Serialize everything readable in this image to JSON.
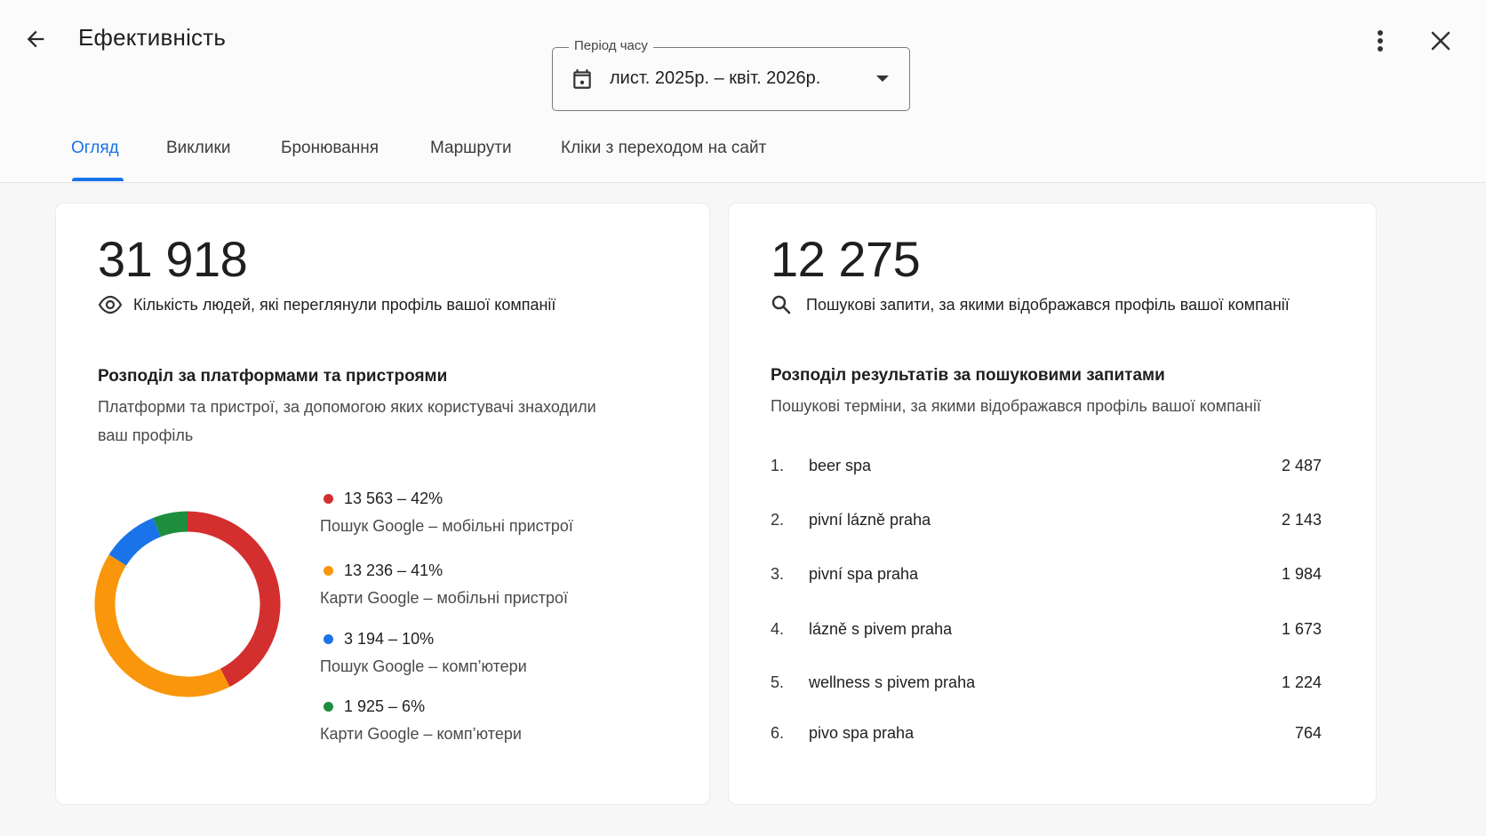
{
  "header": {
    "title": "Ефективність",
    "back_icon": "arrow-left-icon",
    "more_icon": "more-vert-icon",
    "close_icon": "close-icon"
  },
  "period": {
    "label": "Період часу",
    "value": "лист. 2025р. – квіт. 2026р.",
    "icon": "calendar-icon"
  },
  "tabs": [
    {
      "label": "Огляд",
      "active": true
    },
    {
      "label": "Виклики"
    },
    {
      "label": "Бронювання"
    },
    {
      "label": "Маршрути"
    },
    {
      "label": "Кліки з переходом на сайт"
    }
  ],
  "colors": {
    "accent": "#1a73e8",
    "red": "#d32f2f",
    "orange": "#f9960c",
    "blue": "#1a73e8",
    "green": "#1e8e3e"
  },
  "profile_views": {
    "number": "31 918",
    "label": "Кількість людей, які переглянули профіль вашої компанії",
    "icon": "eye-icon",
    "section_title": "Розподіл за платформами та пристроями",
    "section_sub_1": "Платформи та пристрої, за допомогою яких користувачі знаходили",
    "section_sub_2": "ваш профіль"
  },
  "chart_data": {
    "type": "pie",
    "categories": [
      "Пошук Google – мобільні пристрої",
      "Карти Google – мобільні пристрої",
      "Пошук Google – комп’ютери",
      "Карти Google – комп’ютери"
    ],
    "values": [
      13563,
      13236,
      3194,
      1925
    ],
    "percent": [
      42,
      41,
      10,
      6
    ],
    "labels": [
      "13 563 – 42%",
      "13 236 – 41%",
      "3 194 – 10%",
      "1 925 – 6%"
    ],
    "colors": [
      "#d32f2f",
      "#f9960c",
      "#1a73e8",
      "#1e8e3e"
    ]
  },
  "search_queries": {
    "number": "12 275",
    "label": "Пошукові запити, за якими відображався профіль вашої компанії",
    "icon": "search-icon",
    "section_title": "Розподіл результатів за пошуковими запитами",
    "section_sub": "Пошукові терміни, за якими відображався профіль вашої компанії",
    "items": [
      {
        "rank": "1.",
        "term": "beer spa",
        "count": "2 487"
      },
      {
        "rank": "2.",
        "term": "pivní lázně praha",
        "count": "2 143"
      },
      {
        "rank": "3.",
        "term": "pivní spa praha",
        "count": "1 984"
      },
      {
        "rank": "4.",
        "term": "lázně s pivem praha",
        "count": "1 673"
      },
      {
        "rank": "5.",
        "term": "wellness s pivem praha",
        "count": "1 224"
      },
      {
        "rank": "6.",
        "term": "pivo spa praha",
        "count": "764"
      }
    ]
  }
}
